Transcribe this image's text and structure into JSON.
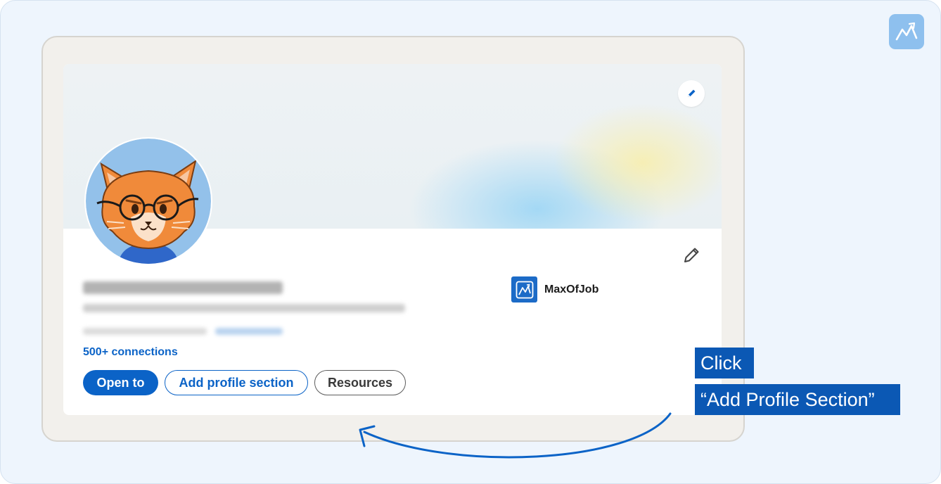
{
  "brand": {
    "icon": "mountain-chart-icon",
    "color": "#8ec0ee"
  },
  "profile": {
    "connections": "500+ connections",
    "company": {
      "name": "MaxOfJob",
      "icon": "maxofjob-logo-icon"
    }
  },
  "buttons": {
    "open_to": "Open to",
    "add_section": "Add profile section",
    "resources": "Resources"
  },
  "callout": {
    "line1": "Click",
    "line2": "“Add Profile Section”"
  },
  "colors": {
    "accent": "#0b63c7",
    "callout_bg": "#0b58b4",
    "canvas_bg": "#eef5fd",
    "frame_bg": "#f2f0ec"
  }
}
